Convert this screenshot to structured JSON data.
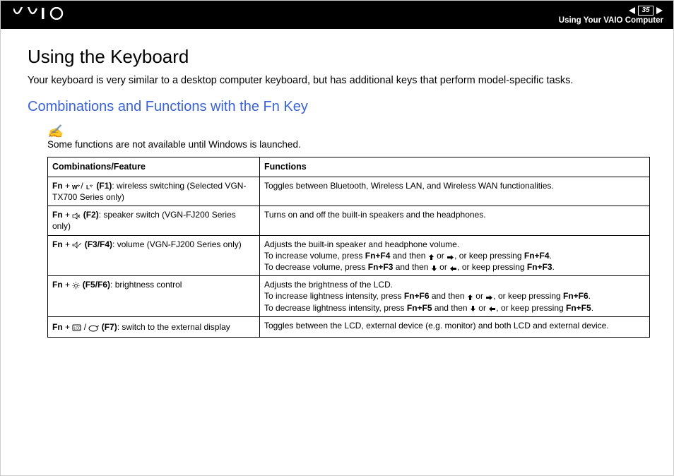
{
  "header": {
    "page_number": "35",
    "section_label": "Using Your VAIO Computer"
  },
  "title": "Using the Keyboard",
  "intro": "Your keyboard is very similar to a desktop computer keyboard, but has additional keys that perform model-specific tasks.",
  "subtitle": "Combinations and Functions with the Fn Key",
  "note": "Some functions are not available until Windows is launched.",
  "table": {
    "col_combo": "Combinations/Feature",
    "col_func": "Functions",
    "rows": [
      {
        "fn": "Fn",
        "key": "(F1)",
        "desc": ": wireless switching (Selected VGN-TX700 Series only)",
        "func": "Toggles between Bluetooth, Wireless LAN, and Wireless WAN functionalities."
      },
      {
        "fn": "Fn",
        "key": "(F2)",
        "desc": ": speaker switch (VGN-FJ200 Series only)",
        "func": "Turns on and off the built-in speakers and the headphones."
      },
      {
        "fn": "Fn",
        "key": "(F3/F4)",
        "desc": ": volume (VGN-FJ200 Series only)",
        "func_line1": "Adjusts the built-in speaker and headphone volume.",
        "f_inc_a": "To increase volume, press ",
        "f_inc_b1": "Fn+F4",
        "f_inc_c": " and then ",
        "f_inc_d": " or ",
        "f_inc_e": ", or keep pressing ",
        "f_inc_b2": "Fn+F4",
        "f_dec_a": "To decrease volume, press ",
        "f_dec_b1": "Fn+F3",
        "f_dec_c": " and then ",
        "f_dec_d": " or ",
        "f_dec_e": ", or keep pressing ",
        "f_dec_b2": "Fn+F3"
      },
      {
        "fn": "Fn",
        "key": "(F5/F6)",
        "desc": ": brightness control",
        "func_line1": "Adjusts the brightness of the LCD.",
        "f_inc_a": "To increase lightness intensity, press ",
        "f_inc_b1": "Fn+F6",
        "f_inc_c": " and then ",
        "f_inc_d": " or ",
        "f_inc_e": ", or keep pressing ",
        "f_inc_b2": "Fn+F6",
        "f_dec_a": "To decrease lightness intensity, press ",
        "f_dec_b1": "Fn+F5",
        "f_dec_c": " and then ",
        "f_dec_d": " or ",
        "f_dec_e": ", or keep pressing ",
        "f_dec_b2": "Fn+F5"
      },
      {
        "fn": "Fn",
        "key": "(F7)",
        "desc": ": switch to the external display",
        "func": "Toggles between the LCD, external device (e.g. monitor) and both LCD and external device."
      }
    ]
  }
}
